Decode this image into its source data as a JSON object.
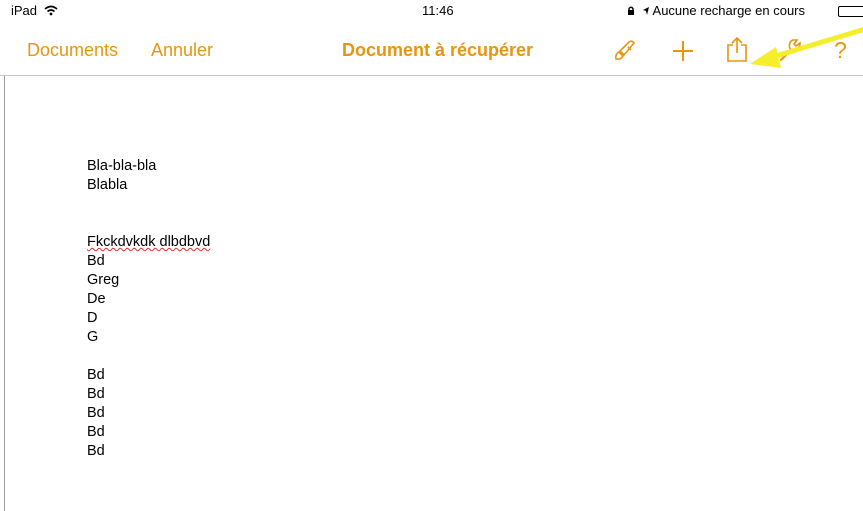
{
  "status": {
    "device": "iPad",
    "time": "11:46",
    "battery": "Aucune recharge en cours"
  },
  "nav": {
    "back_label": "Documents",
    "cancel_label": "Annuler",
    "title": "Document à récupérer",
    "help_label": "?"
  },
  "document": {
    "lines": [
      "Bla-bla-bla",
      "Blabla",
      "",
      "",
      "Fkckdvkdk dlbdbvd",
      "Bd",
      "Greg",
      "De",
      "D",
      "G",
      "",
      "Bd",
      "Bd",
      "Bd",
      "Bd",
      "Bd"
    ]
  },
  "colors": {
    "accent": "#e8950f",
    "annotation_arrow": "#f5ee2a"
  },
  "icons": [
    "wifi-icon",
    "battery-icon",
    "paintbrush-icon",
    "plus-icon",
    "share-icon",
    "wrench-icon",
    "help-icon"
  ]
}
